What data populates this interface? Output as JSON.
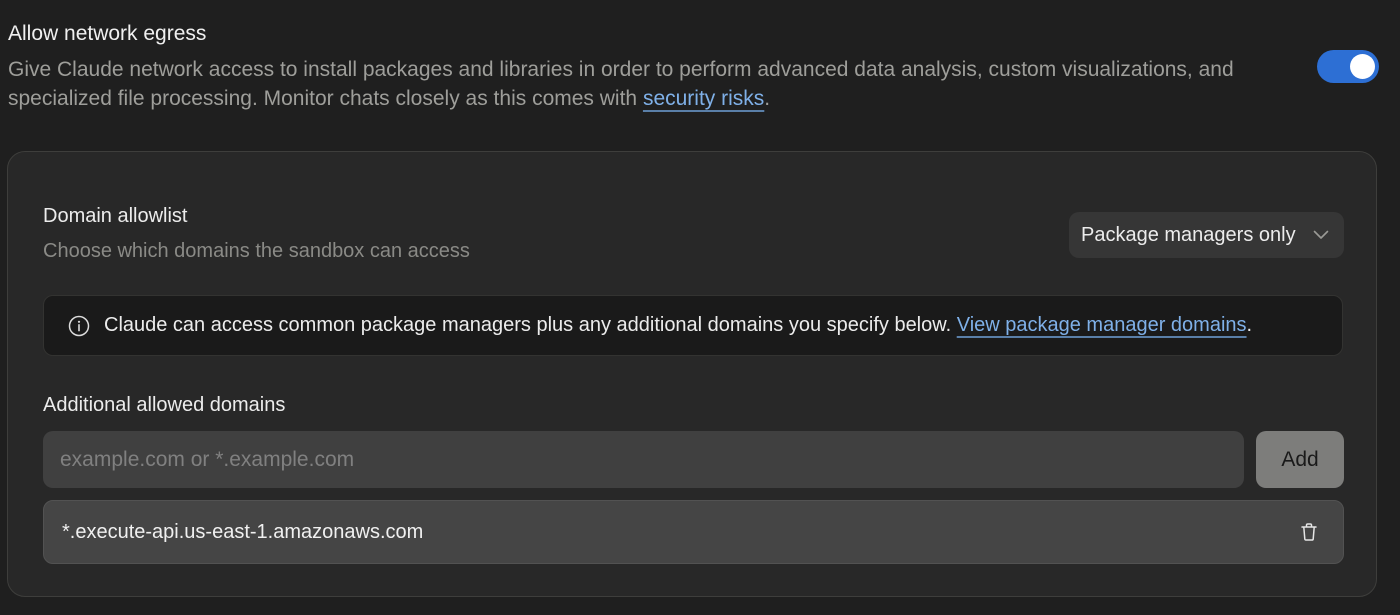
{
  "egress": {
    "title": "Allow network egress",
    "description_pre": "Give Claude network access to install packages and libraries in order to perform advanced data analysis, custom visualizations, and specialized file processing. Monitor chats closely as this comes with ",
    "description_link": "security risks",
    "description_post": ".",
    "toggle_on": true,
    "toggle_color": "#2d6fd4"
  },
  "allowlist": {
    "title": "Domain allowlist",
    "description": "Choose which domains the sandbox can access",
    "dropdown_value": "Package managers only"
  },
  "info_banner": {
    "text": "Claude can access common package managers plus any additional domains you specify below. ",
    "link": "View package manager domains",
    "suffix": "."
  },
  "additional": {
    "title": "Additional allowed domains",
    "input_placeholder": "example.com or *.example.com",
    "input_value": "",
    "add_label": "Add",
    "domains": [
      "*.execute-api.us-east-1.amazonaws.com"
    ]
  }
}
